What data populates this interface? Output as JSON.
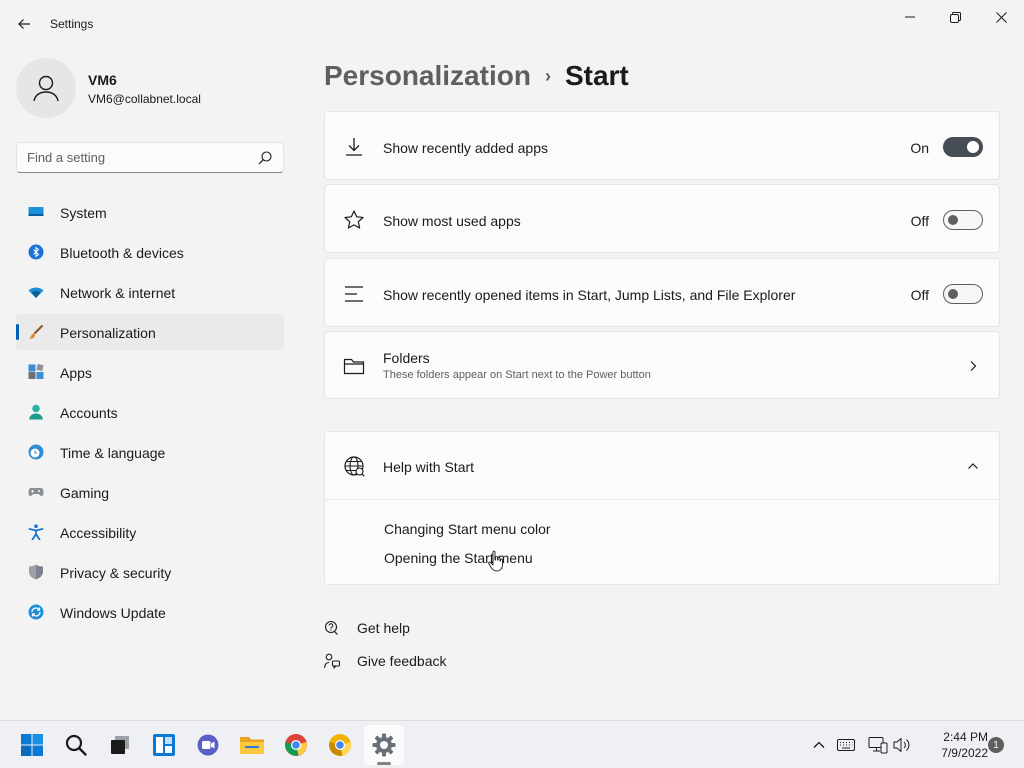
{
  "app": {
    "title": "Settings"
  },
  "profile": {
    "name": "VM6",
    "email": "VM6@collabnet.local"
  },
  "search": {
    "placeholder": "Find a setting"
  },
  "sidebar": {
    "items": [
      {
        "label": "System",
        "icon": "system-icon"
      },
      {
        "label": "Bluetooth & devices",
        "icon": "bluetooth-icon"
      },
      {
        "label": "Network & internet",
        "icon": "wifi-icon"
      },
      {
        "label": "Personalization",
        "icon": "brush-icon",
        "active": true
      },
      {
        "label": "Apps",
        "icon": "apps-icon"
      },
      {
        "label": "Accounts",
        "icon": "person-icon"
      },
      {
        "label": "Time & language",
        "icon": "clock-icon"
      },
      {
        "label": "Gaming",
        "icon": "gamepad-icon"
      },
      {
        "label": "Accessibility",
        "icon": "accessibility-icon"
      },
      {
        "label": "Privacy & security",
        "icon": "shield-icon"
      },
      {
        "label": "Windows Update",
        "icon": "update-icon"
      }
    ]
  },
  "breadcrumb": {
    "parent": "Personalization",
    "separator": "›",
    "current": "Start"
  },
  "settings": [
    {
      "label": "Show recently added apps",
      "state": "On",
      "on": true,
      "icon": "download-icon"
    },
    {
      "label": "Show most used apps",
      "state": "Off",
      "on": false,
      "icon": "star-icon"
    },
    {
      "label": "Show recently opened items in Start, Jump Lists, and File Explorer",
      "state": "Off",
      "on": false,
      "icon": "list-icon"
    }
  ],
  "folders": {
    "label": "Folders",
    "description": "These folders appear on Start next to the Power button",
    "icon": "folder-icon"
  },
  "help": {
    "title": "Help with Start",
    "icon": "globe-icon",
    "expanded": true,
    "links": [
      "Changing Start menu color",
      "Opening the Start menu"
    ]
  },
  "footer": {
    "get_help": "Get help",
    "give_feedback": "Give feedback"
  },
  "taskbar": {
    "time": "2:44 PM",
    "date": "7/9/2022",
    "notifications": "1"
  },
  "colors": {
    "accent": "#005fb8",
    "toggle_on": "#474d55",
    "background": "#f3f3f3",
    "card": "#fbfbfb"
  }
}
